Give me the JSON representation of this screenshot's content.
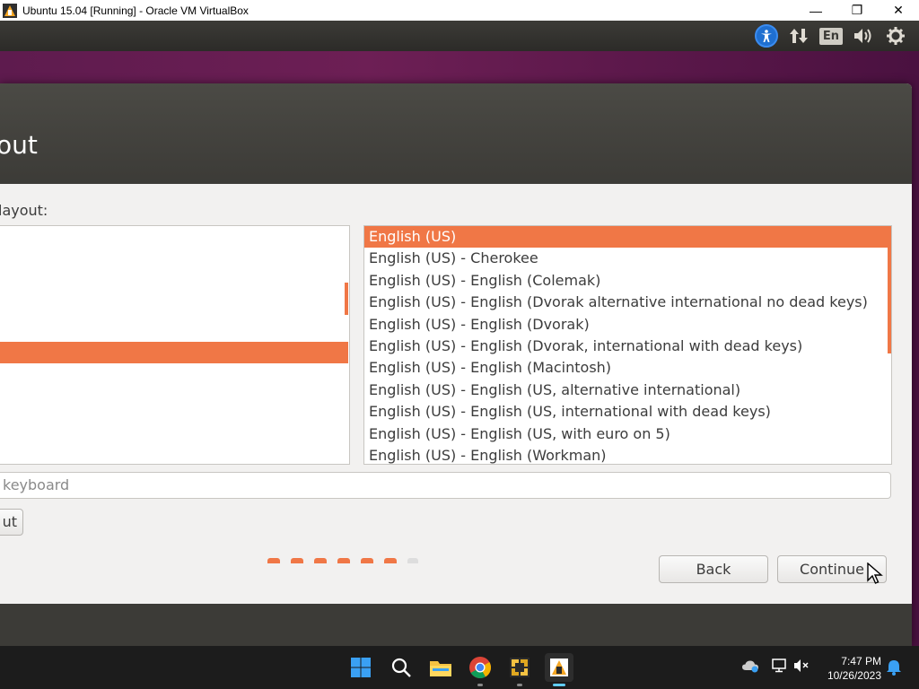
{
  "window": {
    "title": "Ubuntu 15.04 [Running] - Oracle VM VirtualBox",
    "minimize": "—",
    "restore": "❐",
    "close": "✕"
  },
  "panel": {
    "language_indicator": "En"
  },
  "installer": {
    "title": "out",
    "choose_label": "layout:",
    "layout_variants": [
      "English (US)",
      "English (US) - Cherokee",
      "English (US) - English (Colemak)",
      "English (US) - English (Dvorak alternative international no dead keys)",
      "English (US) - English (Dvorak)",
      "English (US) - English (Dvorak, international with dead keys)",
      "English (US) - English (Macintosh)",
      "English (US) - English (US, alternative international)",
      "English (US) - English (US, international with dead keys)",
      "English (US) - English (US, with euro on 5)",
      "English (US) - English (Workman)"
    ],
    "selected_variant": "English (US)",
    "test_placeholder": "keyboard",
    "detect_label": "ut",
    "back_label": "Back",
    "continue_label": "Continue",
    "progress_steps_done": 6,
    "progress_steps_total": 7
  },
  "taskbar": {
    "time": "7:47 PM",
    "date": "10/26/2023"
  },
  "colors": {
    "accent": "#f07746",
    "header": "#3c3b37",
    "taskbar": "#1c1c1c"
  }
}
